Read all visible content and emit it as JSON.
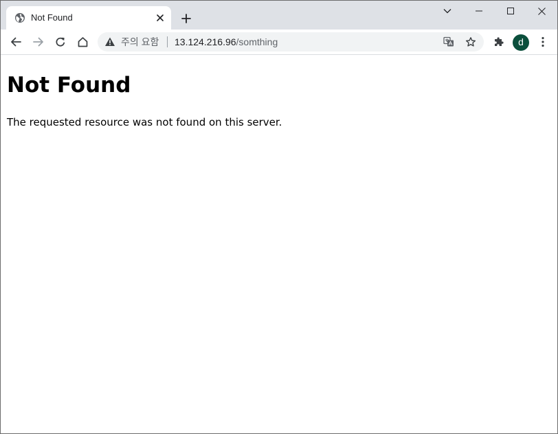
{
  "browser": {
    "tab": {
      "title": "Not Found",
      "favicon": "globe-icon",
      "close_icon": "close-icon"
    },
    "new_tab_icon": "plus-icon",
    "window_controls": [
      "chevron-down-icon",
      "minimize-icon",
      "maximize-icon",
      "close-icon"
    ],
    "nav": {
      "back_icon": "arrow-left-icon",
      "forward_icon": "arrow-right-icon",
      "reload_icon": "reload-icon",
      "home_icon": "home-icon"
    },
    "omnibox": {
      "security_icon": "warning-icon",
      "security_label": "주의 요함",
      "url_host": "13.124.216.96",
      "url_path": "/somthing",
      "translate_icon": "translate-icon",
      "bookmark_icon": "star-icon"
    },
    "extensions_icon": "puzzle-icon",
    "profile_initial": "d",
    "menu_icon": "kebab-menu-icon",
    "colors": {
      "tabstrip_bg": "#dee1e6",
      "omnibox_bg": "#f1f3f4",
      "avatar_bg": "#0b4f3c"
    }
  },
  "page": {
    "heading": "Not Found",
    "message": "The requested resource was not found on this server."
  }
}
